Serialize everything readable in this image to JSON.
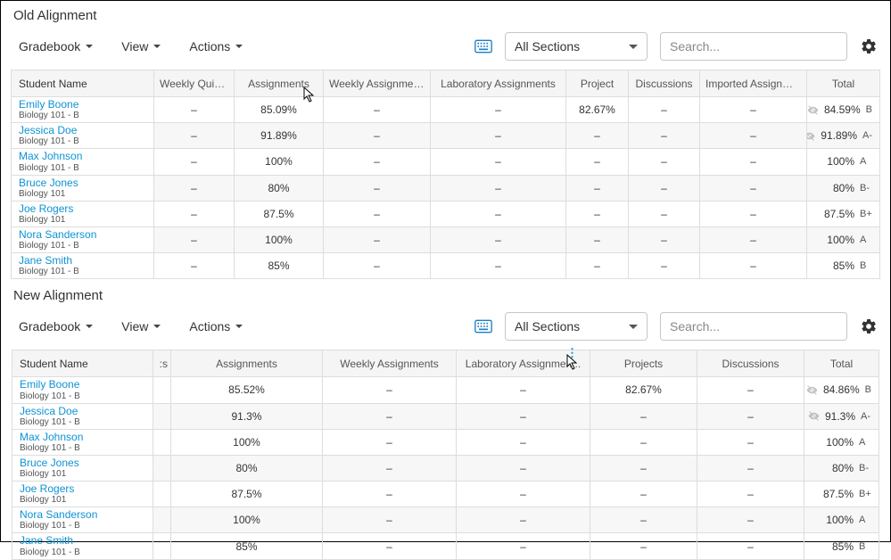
{
  "old": {
    "title": "Old Alignment",
    "toolbar": {
      "gradebook": "Gradebook",
      "view": "View",
      "actions": "Actions",
      "sections_value": "All Sections",
      "search_placeholder": "Search..."
    },
    "columns": [
      "Student Name",
      "Weekly Quizzes",
      "Assignments",
      "Weekly Assignments",
      "Laboratory Assignments",
      "Project",
      "Discussions",
      "Imported Assignments",
      "Total"
    ],
    "rows": [
      {
        "name": "Emily Boone",
        "sub": "Biology 101 - B",
        "cells": [
          "–",
          "85.09%",
          "–",
          "–",
          "82.67%",
          "–",
          "–"
        ],
        "hidden": true,
        "total": "84.59%",
        "letter": "B"
      },
      {
        "name": "Jessica Doe",
        "sub": "Biology 101 - B",
        "cells": [
          "–",
          "91.89%",
          "–",
          "–",
          "–",
          "–",
          "–"
        ],
        "hidden": true,
        "total": "91.89%",
        "letter": "A-"
      },
      {
        "name": "Max Johnson",
        "sub": "Biology 101 - B",
        "cells": [
          "–",
          "100%",
          "–",
          "–",
          "–",
          "–",
          "–"
        ],
        "hidden": false,
        "total": "100%",
        "letter": "A"
      },
      {
        "name": "Bruce Jones",
        "sub": "Biology 101",
        "cells": [
          "–",
          "80%",
          "–",
          "–",
          "–",
          "–",
          "–"
        ],
        "hidden": false,
        "total": "80%",
        "letter": "B-"
      },
      {
        "name": "Joe Rogers",
        "sub": "Biology 101",
        "cells": [
          "–",
          "87.5%",
          "–",
          "–",
          "–",
          "–",
          "–"
        ],
        "hidden": false,
        "total": "87.5%",
        "letter": "B+"
      },
      {
        "name": "Nora Sanderson",
        "sub": "Biology 101 - B",
        "cells": [
          "–",
          "100%",
          "–",
          "–",
          "–",
          "–",
          "–"
        ],
        "hidden": false,
        "total": "100%",
        "letter": "A"
      },
      {
        "name": "Jane Smith",
        "sub": "Biology 101 - B",
        "cells": [
          "–",
          "85%",
          "–",
          "–",
          "–",
          "–",
          "–"
        ],
        "hidden": false,
        "total": "85%",
        "letter": "B"
      }
    ]
  },
  "new": {
    "title": "New Alignment",
    "toolbar": {
      "gradebook": "Gradebook",
      "view": "View",
      "actions": "Actions",
      "sections_value": "All Sections",
      "search_placeholder": "Search..."
    },
    "columns": [
      "Student Name",
      ":s",
      "Assignments",
      "Weekly Assignments",
      "Laboratory Assignmen...",
      "Projects",
      "Discussions",
      "Total"
    ],
    "rows": [
      {
        "name": "Emily Boone",
        "sub": "Biology 101 - B",
        "cells": [
          "",
          "85.52%",
          "–",
          "–",
          "82.67%",
          "–"
        ],
        "hidden": true,
        "total": "84.86%",
        "letter": "B"
      },
      {
        "name": "Jessica Doe",
        "sub": "Biology 101 - B",
        "cells": [
          "",
          "91.3%",
          "–",
          "–",
          "–",
          "–"
        ],
        "hidden": true,
        "total": "91.3%",
        "letter": "A-"
      },
      {
        "name": "Max Johnson",
        "sub": "Biology 101 - B",
        "cells": [
          "",
          "100%",
          "–",
          "–",
          "–",
          "–"
        ],
        "hidden": false,
        "total": "100%",
        "letter": "A"
      },
      {
        "name": "Bruce Jones",
        "sub": "Biology 101",
        "cells": [
          "",
          "80%",
          "–",
          "–",
          "–",
          "–"
        ],
        "hidden": false,
        "total": "80%",
        "letter": "B-"
      },
      {
        "name": "Joe Rogers",
        "sub": "Biology 101",
        "cells": [
          "",
          "87.5%",
          "–",
          "–",
          "–",
          "–"
        ],
        "hidden": false,
        "total": "87.5%",
        "letter": "B+"
      },
      {
        "name": "Nora Sanderson",
        "sub": "Biology 101 - B",
        "cells": [
          "",
          "100%",
          "–",
          "–",
          "–",
          "–"
        ],
        "hidden": false,
        "total": "100%",
        "letter": "A"
      },
      {
        "name": "Jane Smith",
        "sub": "Biology 101 - B",
        "cells": [
          "",
          "85%",
          "–",
          "–",
          "–",
          "–"
        ],
        "hidden": false,
        "total": "85%",
        "letter": "B"
      }
    ]
  }
}
